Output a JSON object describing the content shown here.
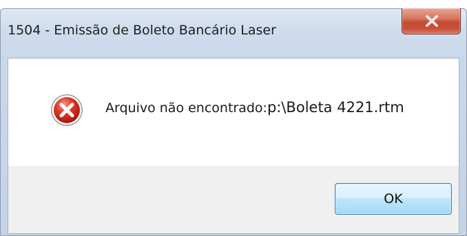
{
  "window": {
    "title": "1504 - Emissão de Boleto Bancário Laser",
    "close_glyph": "x"
  },
  "message": {
    "text": "Arquivo não encontrado:",
    "path": "p:\\Boleta 4221.rtm",
    "icon": "error-icon"
  },
  "buttons": {
    "ok_label": "OK"
  },
  "colors": {
    "close_button": "#c24b31",
    "ok_button_border": "#3c7fb1",
    "error_icon_red": "#d42a20"
  }
}
